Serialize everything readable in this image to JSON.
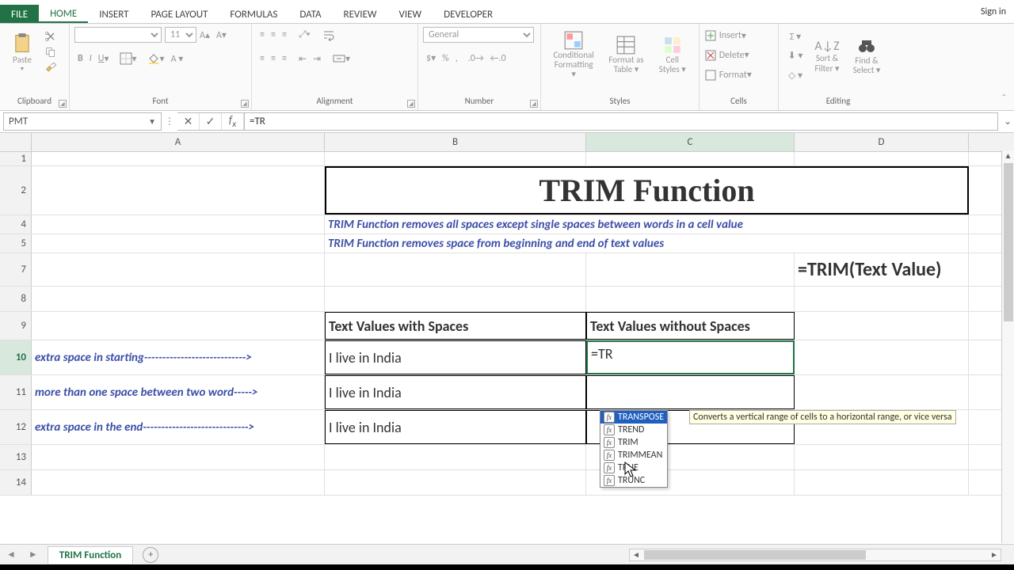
{
  "titlebar": {
    "signin": "Sign in"
  },
  "tabs": {
    "file": "FILE",
    "items": [
      "HOME",
      "INSERT",
      "PAGE LAYOUT",
      "FORMULAS",
      "DATA",
      "REVIEW",
      "VIEW",
      "DEVELOPER"
    ],
    "active": "HOME"
  },
  "ribbon": {
    "clipboard": {
      "label": "Clipboard",
      "paste": "Paste"
    },
    "font": {
      "label": "Font",
      "name": "",
      "size": "11"
    },
    "alignment": {
      "label": "Alignment"
    },
    "number": {
      "label": "Number",
      "format": "General",
      "currency": "$",
      "percent": "%"
    },
    "styles": {
      "label": "Styles",
      "cond": "Conditional Formatting",
      "table": "Format as Table",
      "cell": "Cell Styles"
    },
    "cells": {
      "label": "Cells",
      "insert": "Insert",
      "delete": "Delete",
      "format": "Format"
    },
    "editing": {
      "label": "Editing",
      "sort": "Sort & Filter",
      "find": "Find & Select"
    }
  },
  "formula_bar": {
    "name_box": "PMT",
    "formula": "=TR"
  },
  "columns": [
    "A",
    "B",
    "C",
    "D"
  ],
  "rows": {
    "title": "TRIM Function",
    "desc1": "TRIM Function removes all spaces except single spaces between words in a cell value",
    "desc2": "TRIM Function removes space from beginning and end of text values",
    "syntax": "=TRIM(Text Value)",
    "hdr_b": "Text Values with Spaces",
    "hdr_c": "Text Values without Spaces",
    "r10_a": "extra space in starting---------------------------->",
    "r10_b": "  I live in India",
    "r10_c": "=TR",
    "r11_a": "more than one space between two word----->",
    "r11_b": "I live    in India",
    "r12_a": "extra space in the end----------------------------->",
    "r12_b": "I live in India"
  },
  "row_numbers": [
    "1",
    "2",
    "4",
    "5",
    "7",
    "8",
    "9",
    "10",
    "11",
    "12",
    "13",
    "14"
  ],
  "autocomplete": {
    "tip": "Converts a vertical range of cells to a horizontal range, or vice versa",
    "items": [
      "TRANSPOSE",
      "TREND",
      "TRIM",
      "TRIMMEAN",
      "TRUE",
      "TRUNC"
    ],
    "selected": "TRANSPOSE"
  },
  "sheet": {
    "name": "TRIM Function"
  }
}
